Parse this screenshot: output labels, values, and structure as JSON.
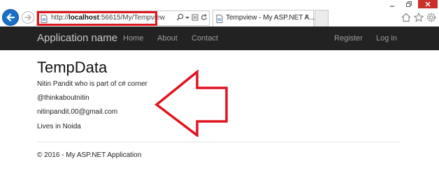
{
  "browser": {
    "url_prefix": "http://",
    "url_host": "localhost",
    "url_rest": ":56615/My/Tempview",
    "tab_title": "Tempview - My ASP.NET A...",
    "tab_close": "×"
  },
  "navbar": {
    "brand": "Application name",
    "links": [
      "Home",
      "About",
      "Contact"
    ],
    "right_links": [
      "Register",
      "Log in"
    ]
  },
  "content": {
    "title": "TempData",
    "lines": [
      "Nitin Pandit who is part of c# corner",
      "@thinkaboutnitin",
      "nitinpandit.00@gmail.com",
      "Lives in Noida"
    ]
  },
  "footer": {
    "text": "© 2016 - My ASP.NET Application"
  },
  "colors": {
    "navbar_bg": "#222222",
    "highlight": "#e0141e",
    "back_button": "#1a6fc9"
  },
  "icons": [
    "back-arrow-icon",
    "forward-arrow-icon",
    "page-icon",
    "search-icon",
    "dropdown-icon",
    "compat-icon",
    "refresh-icon",
    "home-icon",
    "star-icon",
    "gear-icon",
    "minimize-icon",
    "restore-icon",
    "close-icon"
  ]
}
